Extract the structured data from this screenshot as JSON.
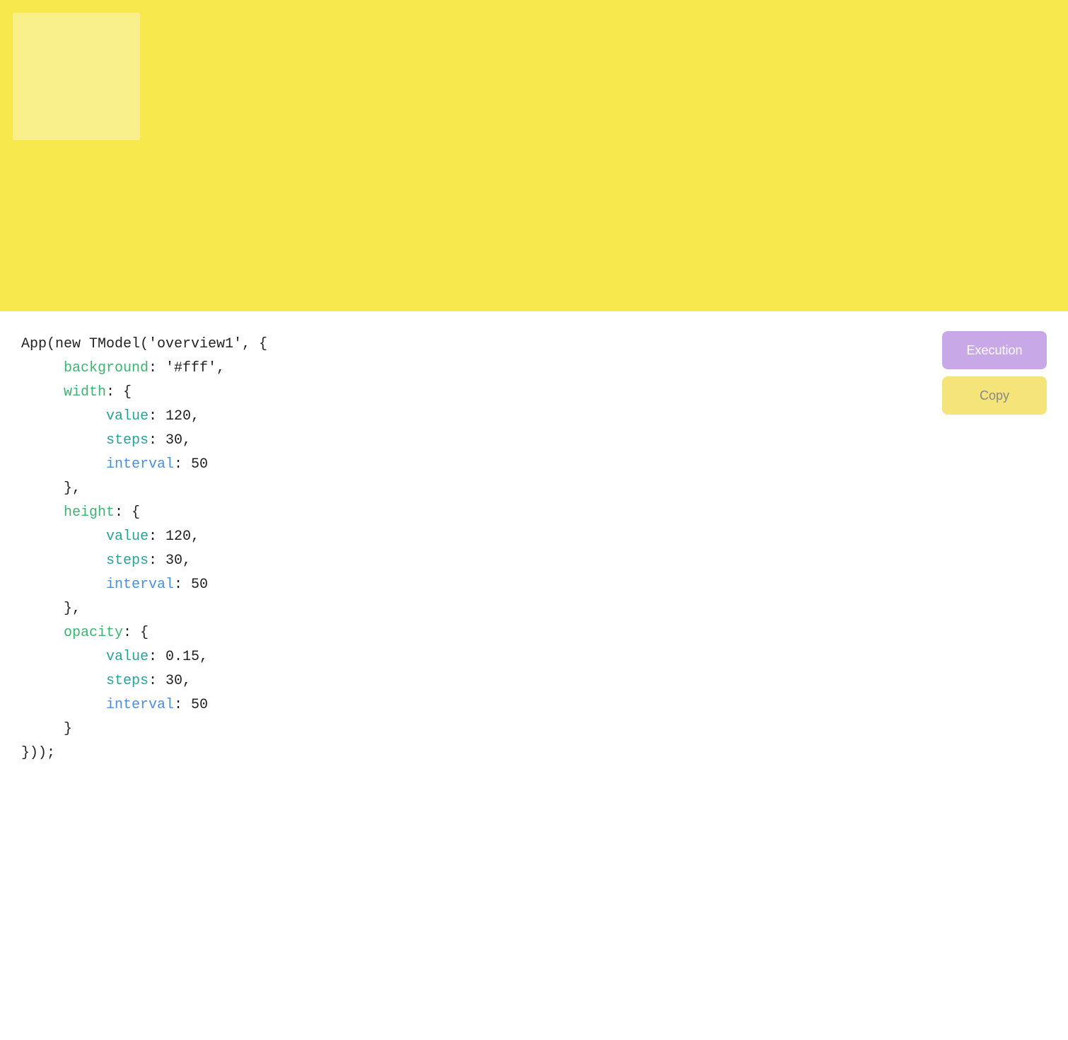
{
  "preview": {
    "bg_color": "#f7e84e",
    "inner_box_color": "rgba(255,255,255,0.35)"
  },
  "buttons": {
    "execution_label": "Execution",
    "copy_label": "Copy"
  },
  "code": {
    "line1": "App(new TModel('overview1', {",
    "line2_key": "background",
    "line2_val": ": '#fff',",
    "line3_key": "width",
    "line3_val": ": {",
    "line4_key": "value",
    "line4_val": ": 120,",
    "line5_key": "steps",
    "line5_val": ": 30,",
    "line6_key": "interval",
    "line6_val": ": 50",
    "line7": "},",
    "line8_key": "height",
    "line8_val": ": {",
    "line9_key": "value",
    "line9_val": ": 120,",
    "line10_key": "steps",
    "line10_val": ": 30,",
    "line11_key": "interval",
    "line11_val": ": 50",
    "line12": "},",
    "line13_key": "opacity",
    "line13_val": ": {",
    "line14_key": "value",
    "line14_val": ": 0.15,",
    "line15_key": "steps",
    "line15_val": ": 30,",
    "line16_key": "interval",
    "line16_val": ": 50",
    "line17": "}",
    "line18": "}));"
  }
}
